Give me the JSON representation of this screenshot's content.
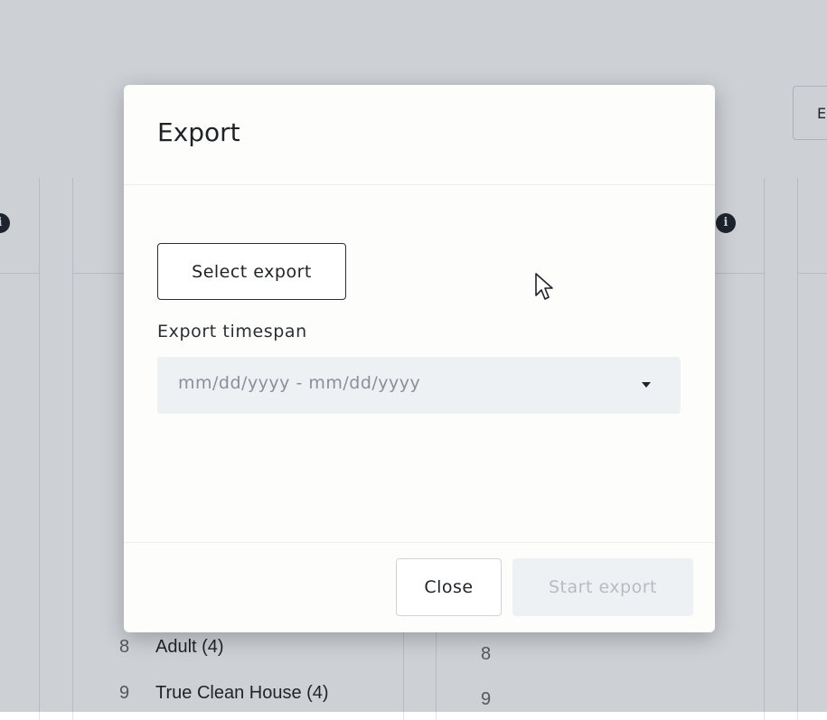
{
  "background": {
    "toolbar_button_label": "E",
    "rows": [
      {
        "number": "8",
        "label": "Adult (4)"
      },
      {
        "number": "9",
        "label": "True Clean House (4)"
      }
    ],
    "column_three_numbers": [
      "8",
      "9"
    ],
    "info_icon_glyph": "i",
    "icons": [
      "info-icon"
    ]
  },
  "modal": {
    "title": "Export",
    "select_export_label": "Select export",
    "timespan_label": "Export timespan",
    "timespan_placeholder": "mm/dd/yyyy - mm/dd/yyyy",
    "close_label": "Close",
    "start_export_label": "Start export",
    "start_export_disabled": true,
    "icons": [
      "caret-down-icon"
    ]
  },
  "colors": {
    "overlay": "#1a2a40",
    "modal_bg": "#fdfdfc",
    "text_dark": "#1f2328",
    "muted_field": "#eef1f4",
    "disabled_text": "#b6bcc4"
  }
}
